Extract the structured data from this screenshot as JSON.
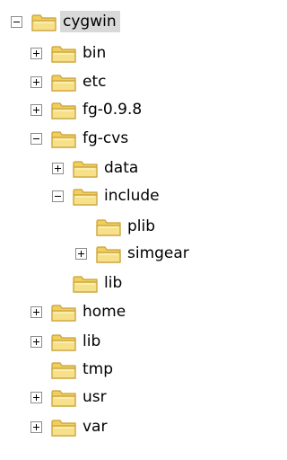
{
  "tree": [
    {
      "label": "cygwin",
      "expander": "minus",
      "icon": "folder-icon",
      "selected": true
    },
    {
      "label": "bin",
      "expander": "plus",
      "icon": "folder-icon"
    },
    {
      "label": "etc",
      "expander": "plus",
      "icon": "folder-icon"
    },
    {
      "label": "fg-0.9.8",
      "expander": "plus",
      "icon": "folder-icon"
    },
    {
      "label": "fg-cvs",
      "expander": "minus",
      "icon": "folder-icon"
    },
    {
      "label": "data",
      "expander": "plus",
      "icon": "folder-icon"
    },
    {
      "label": "include",
      "expander": "minus",
      "icon": "folder-icon"
    },
    {
      "label": "plib",
      "expander": "none",
      "icon": "folder-icon"
    },
    {
      "label": "simgear",
      "expander": "plus",
      "icon": "folder-icon"
    },
    {
      "label": "lib",
      "expander": "none",
      "icon": "folder-icon"
    },
    {
      "label": "home",
      "expander": "plus",
      "icon": "folder-icon"
    },
    {
      "label": "lib",
      "expander": "plus",
      "icon": "folder-icon"
    },
    {
      "label": "tmp",
      "expander": "none",
      "icon": "folder-icon"
    },
    {
      "label": "usr",
      "expander": "plus",
      "icon": "folder-icon"
    },
    {
      "label": "var",
      "expander": "plus",
      "icon": "folder-icon"
    }
  ],
  "colors": {
    "folder_body": "#f7e08a",
    "folder_outline": "#c9a035",
    "folder_tab": "#f0cf5c",
    "selection": "#d9d9d9"
  }
}
